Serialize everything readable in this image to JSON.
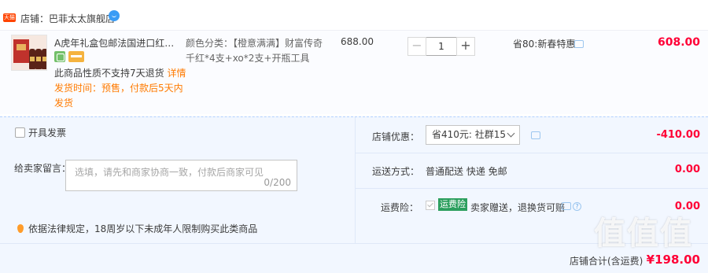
{
  "shop": {
    "logo_text": "天猫",
    "name": "店铺：巴菲太太旗舰店"
  },
  "item": {
    "title": "A虎年礼盒包邮法国进口红酒整...",
    "no_return_text": "此商品性质不支持7天退货",
    "no_return_link": "详情",
    "ship_note": "发货时间：预售，付款后5天内发货",
    "sku": "颜色分类：【橙意满满】财富传奇千红*4支+xo*2支+开瓶工具",
    "unit_price": "688.00",
    "quantity": "1",
    "minus_label": "−",
    "plus_label": "+",
    "promo": "省80:新春特惠",
    "total": "608.00"
  },
  "invoice": {
    "label": "开具发票"
  },
  "message": {
    "label": "给卖家留言：",
    "placeholder": "选填，请先和商家协商一致，付款后商家可见",
    "counter": "0/200"
  },
  "law_note": "依据法律规定，18周岁以下未成年人限制购买此类商品",
  "shop_discount": {
    "label": "店铺优惠：",
    "selected": "省410元: 社群15",
    "amount": "-410.00"
  },
  "shipping": {
    "label": "运送方式：",
    "value": "普通配送 快递 免邮",
    "amount": "0.00"
  },
  "insurance": {
    "label": "运费险：",
    "tag": "运费险",
    "value": "卖家赠送，退换货可赔",
    "amount": "0.00"
  },
  "shop_total": {
    "label": "店铺合计(含运费)",
    "amount": "¥198.00"
  },
  "watermark": "值值值",
  "colors": {
    "price_red": "#ff0036",
    "orange": "#ff7a00",
    "panel_bg": "#f2f7ff",
    "insurance_green": "#2c9f5e"
  }
}
